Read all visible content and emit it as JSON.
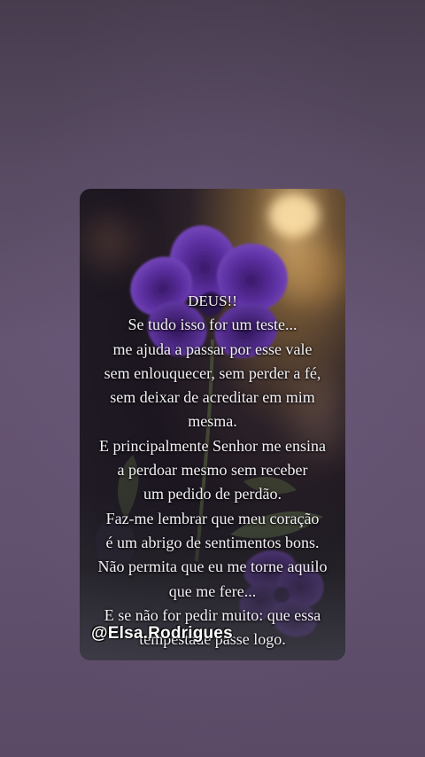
{
  "post": {
    "title": "DEUS!!",
    "lines": [
      "Se tudo isso for um teste...",
      "me ajuda a passar por esse vale",
      "sem enlouquecer, sem perder a fé,",
      "sem deixar de acreditar em mim",
      "mesma.",
      "E principalmente Senhor me ensina",
      "a perdoar mesmo sem receber",
      "um pedido de perdão.",
      "Faz-me lembrar que meu coração",
      "é um abrigo de sentimentos bons.",
      "Não permita que eu me torne aquilo",
      "que me fere...",
      "E se não for pedir muito: que essa",
      "tempestade passe logo."
    ],
    "watermark": "@Elsa.Rodrigues"
  },
  "colors": {
    "background": "#5e4f6b",
    "petal": "#5b2fa0",
    "text": "#f4f1f6"
  },
  "icons": [
    "purple-flower-illustration"
  ]
}
